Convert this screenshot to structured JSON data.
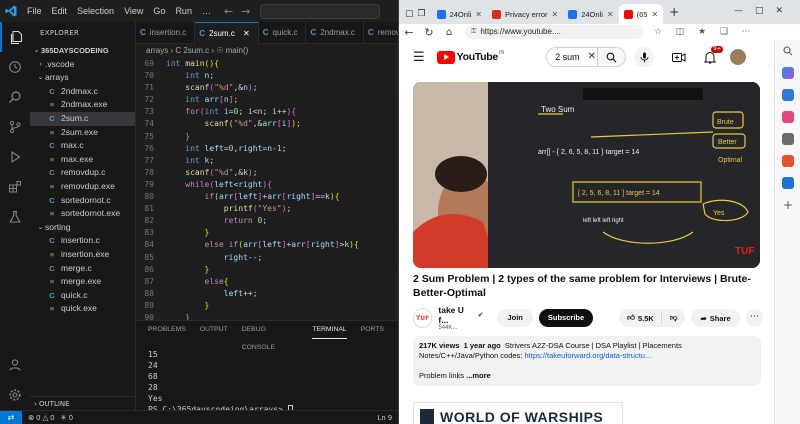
{
  "vscode": {
    "menu": [
      "File",
      "Edit",
      "Selection",
      "View",
      "Go",
      "Run",
      "…"
    ],
    "explorer": {
      "title": "EXPLORER",
      "root": "365DAYSCODEING",
      "items": [
        {
          "label": ".vscode",
          "type": "folder-closed",
          "indent": 1
        },
        {
          "label": "arrays",
          "type": "folder-open",
          "indent": 1
        },
        {
          "label": "2ndmax.c",
          "type": "c",
          "indent": 2
        },
        {
          "label": "2ndmax.exe",
          "type": "exe",
          "indent": 2
        },
        {
          "label": "2sum.c",
          "type": "c",
          "indent": 2,
          "selected": true
        },
        {
          "label": "2sum.exe",
          "type": "exe",
          "indent": 2
        },
        {
          "label": "max.c",
          "type": "c",
          "indent": 2
        },
        {
          "label": "max.exe",
          "type": "exe",
          "indent": 2
        },
        {
          "label": "removdup.c",
          "type": "c",
          "indent": 2
        },
        {
          "label": "removdup.exe",
          "type": "exe",
          "indent": 2
        },
        {
          "label": "sortedornot.c",
          "type": "c",
          "indent": 2
        },
        {
          "label": "sortedornot.exe",
          "type": "exe",
          "indent": 2
        },
        {
          "label": "sorting",
          "type": "folder-open",
          "indent": 1
        },
        {
          "label": "insertion.c",
          "type": "c",
          "indent": 2
        },
        {
          "label": "insertion.exe",
          "type": "exe",
          "indent": 2
        },
        {
          "label": "merge.c",
          "type": "c",
          "indent": 2
        },
        {
          "label": "merge.exe",
          "type": "exe",
          "indent": 2
        },
        {
          "label": "quick.c",
          "type": "c",
          "indent": 2
        },
        {
          "label": "quick.exe",
          "type": "exe",
          "indent": 2
        }
      ],
      "outline": "OUTLINE"
    },
    "tabs": [
      {
        "label": "insertion.c",
        "active": false
      },
      {
        "label": "2sum.c",
        "active": true
      },
      {
        "label": "quick.c",
        "active": false
      },
      {
        "label": "2ndmax.c",
        "active": false
      },
      {
        "label": "remov",
        "active": false
      }
    ],
    "breadcrumb": "arrays › C 2sum.c › ☉ main()",
    "code_lines": [
      {
        "n": "69",
        "html": "<span class=\"kw\">int</span> <span class=\"fn\">main</span><span class=\"br\">()</span><span class=\"br\">{</span>"
      },
      {
        "n": "70",
        "html": "    <span class=\"kw\">int</span> <span class=\"vr\">n</span>;"
      },
      {
        "n": "71",
        "html": "    <span class=\"fn\">scanf</span><span class=\"br2\">(</span><span class=\"st\">\"%d\"</span>,&amp;<span class=\"vr\">n</span><span class=\"br2\">)</span>;"
      },
      {
        "n": "72",
        "html": "    <span class=\"kw\">int</span> <span class=\"vr\">arr</span><span class=\"br2\">[</span><span class=\"vr\">n</span><span class=\"br2\">]</span>;"
      },
      {
        "n": "73",
        "html": "    <span class=\"kc\">for</span><span class=\"br2\">(</span><span class=\"kw\">int</span> <span class=\"vr\">i</span>=<span class=\"nm\">0</span>; <span class=\"vr\">i</span>&lt;<span class=\"vr\">n</span>; <span class=\"vr\">i</span>++<span class=\"br2\">)</span><span class=\"br2\">{</span>"
      },
      {
        "n": "74",
        "html": "        <span class=\"fn\">scanf</span><span class=\"br\">(</span><span class=\"st\">\"%d\"</span>,&amp;<span class=\"vr\">arr</span><span class=\"br2\">[</span><span class=\"vr\">i</span><span class=\"br2\">]</span><span class=\"br\">)</span>;"
      },
      {
        "n": "75",
        "html": "    <span class=\"br2\">}</span>"
      },
      {
        "n": "76",
        "html": "    <span class=\"kw\">int</span> <span class=\"vr\">left</span>=<span class=\"nm\">0</span>,<span class=\"vr\">right</span>=<span class=\"vr\">n</span>-<span class=\"nm\">1</span>;"
      },
      {
        "n": "77",
        "html": "    <span class=\"kw\">int</span> <span class=\"vr\">k</span>;"
      },
      {
        "n": "78",
        "html": "    <span class=\"fn\">scanf</span><span class=\"br2\">(</span><span class=\"st\">\"%d\"</span>,&amp;<span class=\"vr\">k</span><span class=\"br2\">)</span>;"
      },
      {
        "n": "79",
        "html": "    <span class=\"kc\">while</span><span class=\"br2\">(</span><span class=\"vr\">left</span>&lt;<span class=\"vr\">right</span><span class=\"br2\">)</span><span class=\"br2\">{</span>"
      },
      {
        "n": "80",
        "html": "        <span class=\"kc\">if</span><span class=\"br\">(</span><span class=\"vr\">arr</span><span class=\"br2\">[</span><span class=\"vr\">left</span><span class=\"br2\">]</span>+<span class=\"vr\">arr</span><span class=\"br2\">[</span><span class=\"vr\">right</span><span class=\"br2\">]</span>==<span class=\"vr\">k</span><span class=\"br\">)</span><span class=\"br\">{</span>"
      },
      {
        "n": "81",
        "html": "            <span class=\"fn\">printf</span><span class=\"br2\">(</span><span class=\"st\">\"Yes\"</span><span class=\"br2\">)</span>;"
      },
      {
        "n": "82",
        "html": "            <span class=\"kc\">return</span> <span class=\"nm\">0</span>;"
      },
      {
        "n": "83",
        "html": "        <span class=\"br\">}</span>"
      },
      {
        "n": "84",
        "html": "        <span class=\"kc\">else if</span><span class=\"br\">(</span><span class=\"vr\">arr</span><span class=\"br2\">[</span><span class=\"vr\">left</span><span class=\"br2\">]</span>+<span class=\"vr\">arr</span><span class=\"br2\">[</span><span class=\"vr\">right</span><span class=\"br2\">]</span>&gt;<span class=\"vr\">k</span><span class=\"br\">)</span><span class=\"br\">{</span>"
      },
      {
        "n": "85",
        "html": "            <span class=\"vr\">right</span>--;"
      },
      {
        "n": "86",
        "html": "        <span class=\"br\">}</span>"
      },
      {
        "n": "87",
        "html": "        <span class=\"kc\">else</span><span class=\"br\">{</span>"
      },
      {
        "n": "88",
        "html": "            <span class=\"vr\">left</span>++;"
      },
      {
        "n": "89",
        "html": "        <span class=\"br\">}</span>"
      },
      {
        "n": "90",
        "html": "    <span class=\"br2\">}</span>"
      }
    ],
    "panel_tabs": [
      "PROBLEMS",
      "OUTPUT",
      "DEBUG CONSOLE",
      "TERMINAL",
      "PORTS"
    ],
    "panel_active": "TERMINAL",
    "terminal_lines": [
      "15",
      "24",
      "68",
      "28",
      "Yes"
    ],
    "terminal_prompt": "PS C:\\365dayscodeing\\arrays> ",
    "status": {
      "errors": "0",
      "warnings": "0",
      "ports": "0",
      "position": "Ln 9"
    }
  },
  "browser": {
    "tabs": [
      {
        "label": "24Onli",
        "color": "#1a73e8",
        "active": false
      },
      {
        "label": "Privacy error",
        "color": "#d93025",
        "active": false
      },
      {
        "label": "24Onli",
        "color": "#1a73e8",
        "active": false
      },
      {
        "label": "(65",
        "color": "#ff0000",
        "active": true
      }
    ],
    "url": "https://www.youtube....",
    "youtube": {
      "brand": "YouTube",
      "region": "IN",
      "search_value": "2 sum",
      "notification_count": "9+",
      "video_title": "2 Sum Problem | 2 types of the same problem for Interviews | Brute-Better-Optimal",
      "channel_name": "take U f...",
      "channel_subs": "544K...",
      "channel_logo_text": "TUF",
      "join_label": "Join",
      "subscribe_label": "Subscribe",
      "likes": "5.5K",
      "share_label": "Share",
      "views": "217K views",
      "age": "1 year ago",
      "desc_line1": "Strivers A2Z-DSA Course | DSA Playlist | Placements",
      "desc_line2_prefix": "Notes/C++/Java/Python codes: ",
      "desc_link": "https://takeuforward.org/data-structu...",
      "desc_line3": "Problem links",
      "more_label": "...more",
      "ad_text": "WORLD OF WARSHIPS"
    },
    "whiteboard_text": {
      "title": "Two Sum",
      "watermark": "TUF"
    }
  }
}
